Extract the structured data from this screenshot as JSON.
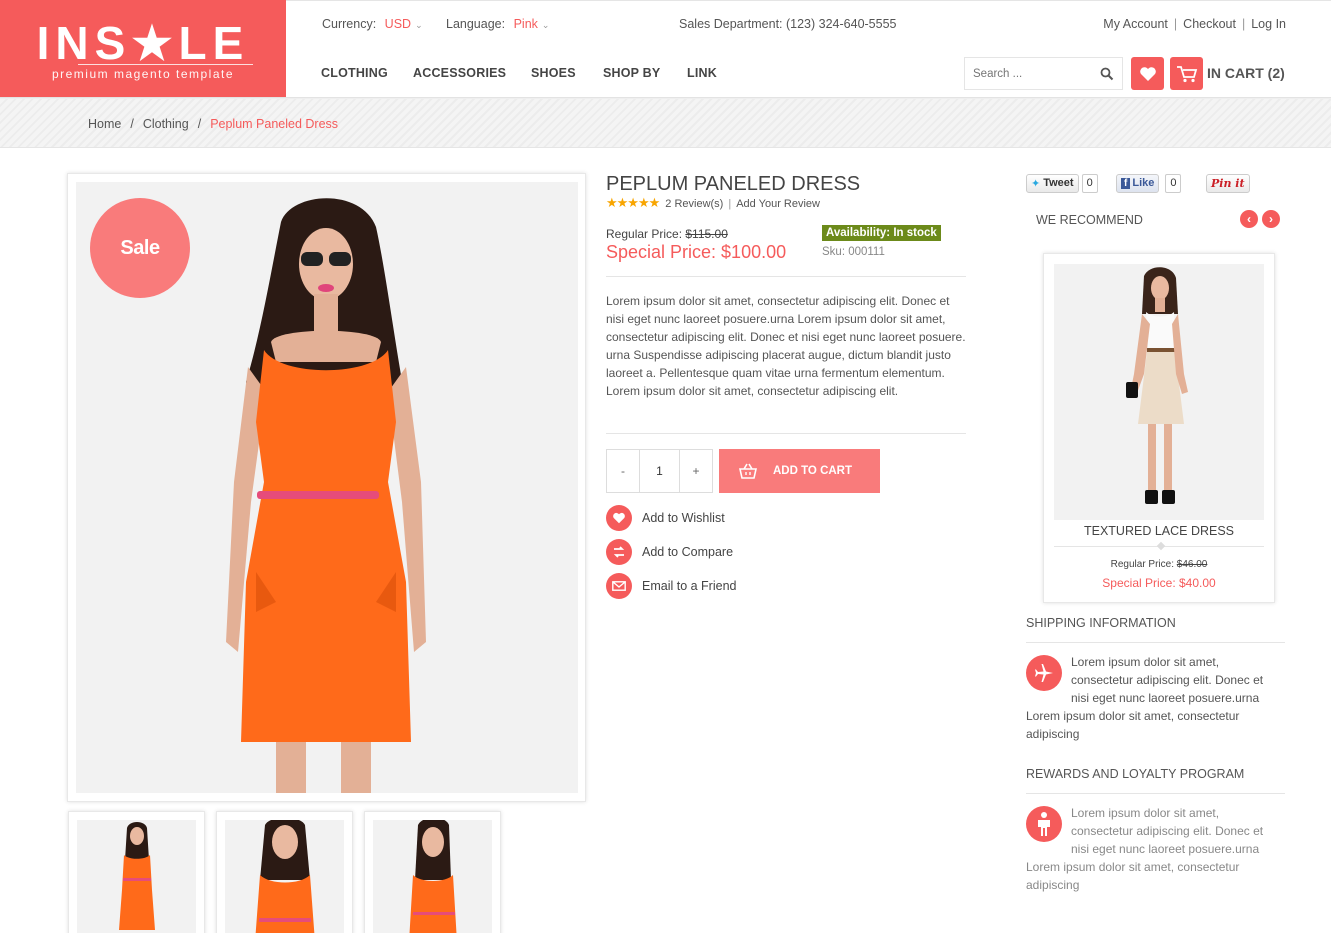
{
  "brand": {
    "logo_text": "INS★LE",
    "tagline": "premium magento template"
  },
  "topbar": {
    "currency_label": "Currency:",
    "currency_value": "USD",
    "language_label": "Language:",
    "language_value": "Pink",
    "sales_text": "Sales Department: (123) 324-640-5555",
    "links": [
      "My Account",
      "Checkout",
      "Log In"
    ]
  },
  "nav": {
    "items": [
      "CLOTHING",
      "ACCESSORIES",
      "SHOES",
      "SHOP BY",
      "LINK"
    ]
  },
  "search": {
    "placeholder": "Search ..."
  },
  "cart": {
    "label": "IN CART (2)"
  },
  "breadcrumb": {
    "items": [
      "Home",
      "Clothing"
    ],
    "current": "Peplum Paneled Dress",
    "separator": "/"
  },
  "product": {
    "sale_badge": "Sale",
    "title": "PEPLUM PANELED DRESS",
    "stars": "★★★★★",
    "reviews_link": "2 Review(s)",
    "add_review_link": "Add Your Review",
    "regular_label": "Regular Price:",
    "regular_price": "$115.00",
    "special_price": "Special Price: $100.00",
    "availability": "Availability: In stock",
    "sku": "Sku: 000111",
    "description": "Lorem ipsum dolor sit amet, consectetur adipiscing elit. Donec et nisi eget nunc laoreet posuere.urna Lorem ipsum dolor sit amet, consectetur adipiscing elit. Donec et nisi eget nunc laoreet posuere. urna Suspendisse adipiscing placerat augue, dictum blandit justo laoreet a. Pellentesque quam vitae urna fermentum elementum. Lorem ipsum dolor sit amet, consectetur adipiscing elit.",
    "qty_minus": "-",
    "qty_value": "1",
    "qty_plus": "+",
    "add_to_cart": "ADD TO CART",
    "actions": [
      "Add to Wishlist",
      "Add to Compare",
      "Email to a Friend"
    ]
  },
  "social": {
    "tweet": "Tweet",
    "tweet_count": "0",
    "like": "Like",
    "like_count": "0",
    "pin": "Pin it"
  },
  "recommend": {
    "heading": "WE RECOMMEND",
    "prev": "‹",
    "next": "›",
    "item": {
      "name": "TEXTURED LACE DRESS",
      "regular_label": "Regular Price:",
      "regular_price": "$46.00",
      "special_price": "Special Price: $40.00"
    }
  },
  "shipping": {
    "heading": "SHIPPING INFORMATION",
    "text": "Lorem ipsum dolor sit amet, consectetur adipiscing elit. Donec et nisi eget nunc laoreet posuere.urna Lorem ipsum dolor sit amet, consectetur adipiscing"
  },
  "rewards": {
    "heading": "REWARDS AND LOYALTY PROGRAM",
    "text": "Lorem ipsum dolor sit amet, consectetur adipiscing elit. Donec et nisi eget nunc laoreet posuere.urna Lorem ipsum dolor sit amet, consectetur adipiscing"
  },
  "colors": {
    "accent": "#f55b5b",
    "badge": "#f97b7b",
    "instock": "#6c8a1a",
    "stars": "#f8a500"
  }
}
